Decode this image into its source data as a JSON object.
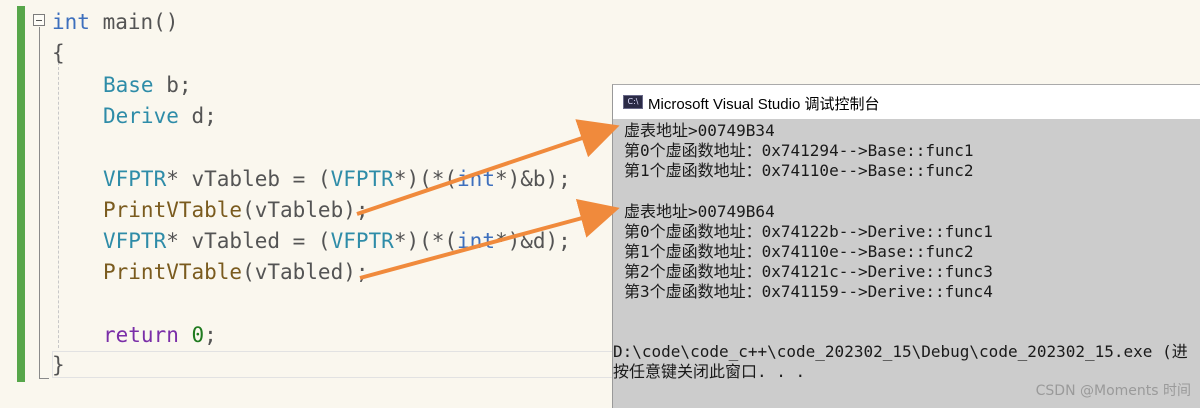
{
  "editor": {
    "lines": [
      {
        "id": "line-main",
        "segments": [
          {
            "t": "int",
            "c": "kw"
          },
          {
            "t": " main()",
            "c": ""
          }
        ]
      },
      {
        "id": "line-open-brace",
        "segments": [
          {
            "t": "{",
            "c": ""
          }
        ]
      },
      {
        "id": "line-base-b",
        "segments": [
          {
            "t": "Base",
            "c": "ty"
          },
          {
            "t": " b;",
            "c": ""
          }
        ]
      },
      {
        "id": "line-derive-d",
        "segments": [
          {
            "t": "Derive",
            "c": "ty"
          },
          {
            "t": " d;",
            "c": ""
          }
        ]
      },
      {
        "id": "line-vtableb",
        "segments": [
          {
            "t": "VFPTR",
            "c": "ty"
          },
          {
            "t": "* vTableb = (",
            "c": ""
          },
          {
            "t": "VFPTR",
            "c": "ty"
          },
          {
            "t": "*)(*(",
            "c": ""
          },
          {
            "t": "int",
            "c": "kw"
          },
          {
            "t": "*)&b);",
            "c": ""
          }
        ]
      },
      {
        "id": "line-print-b",
        "segments": [
          {
            "t": "PrintVTable",
            "c": "fn"
          },
          {
            "t": "(vTableb);",
            "c": ""
          }
        ]
      },
      {
        "id": "line-vtabled",
        "segments": [
          {
            "t": "VFPTR",
            "c": "ty"
          },
          {
            "t": "* vTabled = (",
            "c": ""
          },
          {
            "t": "VFPTR",
            "c": "ty"
          },
          {
            "t": "*)(*(",
            "c": ""
          },
          {
            "t": "int",
            "c": "kw"
          },
          {
            "t": "*)&d);",
            "c": ""
          }
        ]
      },
      {
        "id": "line-print-d",
        "segments": [
          {
            "t": "PrintVTable",
            "c": "fn"
          },
          {
            "t": "(vTabled);",
            "c": ""
          }
        ]
      },
      {
        "id": "line-return",
        "segments": [
          {
            "t": "return",
            "c": "kw2"
          },
          {
            "t": " ",
            "c": ""
          },
          {
            "t": "0",
            "c": "nm"
          },
          {
            "t": ";",
            "c": ""
          }
        ]
      },
      {
        "id": "line-close-brace",
        "segments": [
          {
            "t": "}",
            "c": ""
          }
        ]
      }
    ]
  },
  "console": {
    "title": "Microsoft Visual Studio 调试控制台",
    "icon_text": "C:\\",
    "lines": [
      "虚表地址>00749B34",
      "第0个虚函数地址：0x741294-->Base::func1",
      "第1个虚函数地址：0x74110e-->Base::func2",
      "虚表地址>00749B64",
      "第0个虚函数地址：0x74122b-->Derive::func1",
      "第1个虚函数地址：0x74110e-->Base::func2",
      "第2个虚函数地址：0x74121c-->Derive::func3",
      "第3个虚函数地址：0x741159-->Derive::func4",
      "D:\\code\\code_c++\\code_202302_15\\Debug\\code_202302_15.exe (进",
      "按任意键关闭此窗口. . ."
    ],
    "watermark": "CSDN @Moments 时间"
  },
  "colors": {
    "arrow": "#f08a3c",
    "change_bar": "#57a64a",
    "console_bg": "#cccccc",
    "editor_bg": "#faf7ee"
  }
}
